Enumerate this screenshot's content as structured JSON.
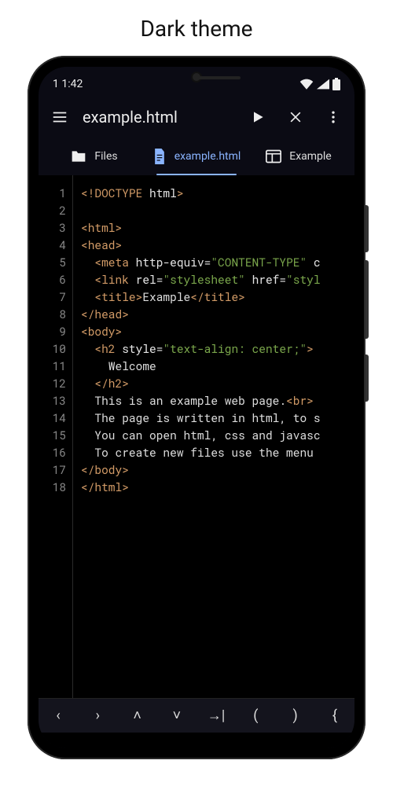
{
  "page_title": "Dark theme",
  "status": {
    "time": "1 1:42"
  },
  "appbar": {
    "title": "example.html"
  },
  "tabs": [
    {
      "id": "files",
      "label": "Files",
      "icon": "folder-icon",
      "active": false
    },
    {
      "id": "example-html",
      "label": "example.html",
      "icon": "file-icon",
      "active": true
    },
    {
      "id": "example",
      "label": "Example",
      "icon": "web-icon",
      "active": false
    }
  ],
  "code_lines": [
    {
      "n": 1,
      "tokens": [
        [
          "doctype",
          "<!DOCTYPE"
        ],
        [
          "text",
          " "
        ],
        [
          "attr",
          "html"
        ],
        [
          "doctype",
          ">"
        ]
      ]
    },
    {
      "n": 2,
      "tokens": []
    },
    {
      "n": 3,
      "tokens": [
        [
          "tag",
          "<html>"
        ]
      ]
    },
    {
      "n": 4,
      "tokens": [
        [
          "tag",
          "<head>"
        ]
      ]
    },
    {
      "n": 5,
      "tokens": [
        [
          "text",
          "  "
        ],
        [
          "tag",
          "<meta"
        ],
        [
          "text",
          " "
        ],
        [
          "attr",
          "http-equiv="
        ],
        [
          "string",
          "\"CONTENT-TYPE\""
        ],
        [
          "text",
          " "
        ],
        [
          "attr",
          "c"
        ]
      ]
    },
    {
      "n": 6,
      "tokens": [
        [
          "text",
          "  "
        ],
        [
          "tag",
          "<link"
        ],
        [
          "text",
          " "
        ],
        [
          "attr",
          "rel="
        ],
        [
          "string",
          "\"stylesheet\""
        ],
        [
          "text",
          " "
        ],
        [
          "attr",
          "href="
        ],
        [
          "string",
          "\"styl"
        ]
      ]
    },
    {
      "n": 7,
      "tokens": [
        [
          "text",
          "  "
        ],
        [
          "tag",
          "<title>"
        ],
        [
          "text",
          "Example"
        ],
        [
          "tag",
          "</title>"
        ]
      ]
    },
    {
      "n": 8,
      "tokens": [
        [
          "tag",
          "</head>"
        ]
      ]
    },
    {
      "n": 9,
      "tokens": [
        [
          "tag",
          "<body>"
        ]
      ]
    },
    {
      "n": 10,
      "tokens": [
        [
          "text",
          "  "
        ],
        [
          "tag",
          "<h2"
        ],
        [
          "text",
          " "
        ],
        [
          "attr",
          "style="
        ],
        [
          "string",
          "\"text-align: center;\""
        ],
        [
          "tag",
          ">"
        ]
      ]
    },
    {
      "n": 11,
      "tokens": [
        [
          "text",
          "    Welcome"
        ]
      ]
    },
    {
      "n": 12,
      "tokens": [
        [
          "text",
          "  "
        ],
        [
          "tag",
          "</h2>"
        ]
      ]
    },
    {
      "n": 13,
      "tokens": [
        [
          "text",
          "  This is an example web page."
        ],
        [
          "tag",
          "<br>"
        ]
      ]
    },
    {
      "n": 14,
      "tokens": [
        [
          "text",
          "  The page is written in html, to s"
        ]
      ]
    },
    {
      "n": 15,
      "tokens": [
        [
          "text",
          "  You can open html, css and javasc"
        ]
      ]
    },
    {
      "n": 16,
      "tokens": [
        [
          "text",
          "  To create new files use the menu "
        ]
      ]
    },
    {
      "n": 17,
      "tokens": [
        [
          "tag",
          "</body>"
        ]
      ]
    },
    {
      "n": 18,
      "tokens": [
        [
          "tag",
          "</html>"
        ]
      ]
    }
  ],
  "bottom_buttons": [
    {
      "id": "prev",
      "glyph": "‹",
      "name": "chevron-left-icon"
    },
    {
      "id": "next",
      "glyph": "›",
      "name": "chevron-right-icon"
    },
    {
      "id": "up",
      "glyph": "˄",
      "name": "chevron-up-icon"
    },
    {
      "id": "down",
      "glyph": "˅",
      "name": "chevron-down-icon"
    },
    {
      "id": "tab",
      "glyph": "→|",
      "name": "tab-icon"
    },
    {
      "id": "paren-open",
      "glyph": "(",
      "name": "paren-open-icon"
    },
    {
      "id": "paren-close",
      "glyph": ")",
      "name": "paren-close-icon"
    },
    {
      "id": "brace-open",
      "glyph": "{",
      "name": "brace-open-icon"
    }
  ]
}
